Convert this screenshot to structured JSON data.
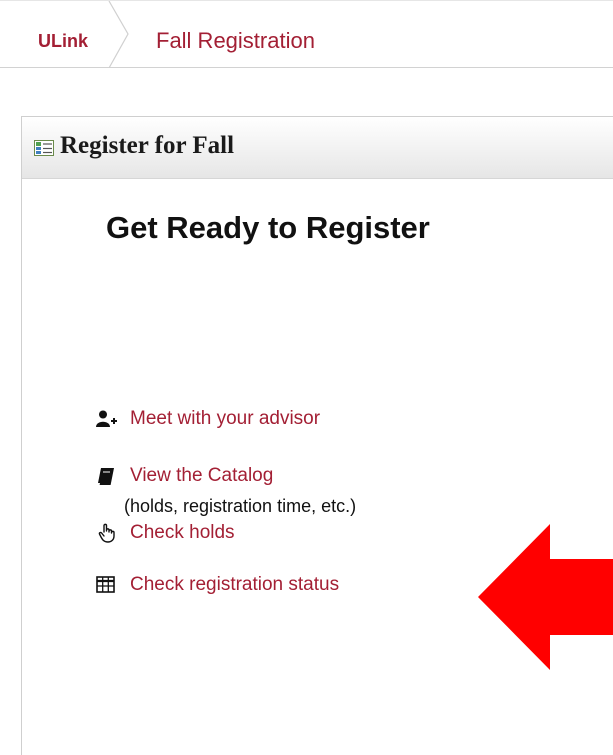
{
  "breadcrumb": {
    "home_label": "ULink",
    "current_label": "Fall Registration"
  },
  "panel": {
    "title": "Register for Fall",
    "icon": "panel-list-icon"
  },
  "section": {
    "title": "Get Ready to Register"
  },
  "links": [
    {
      "icon": "user-add-icon",
      "label": "Meet with your advisor"
    },
    {
      "icon": "book-icon",
      "label": "View the Catalog"
    },
    {
      "icon": "hand-pointer-icon",
      "label": "Check holds"
    },
    {
      "icon": "table-grid-icon",
      "label": "Check registration status"
    }
  ],
  "status_note": "(holds, registration time, etc.)",
  "colors": {
    "link": "#a31f34",
    "arrow": "#ff0000"
  }
}
